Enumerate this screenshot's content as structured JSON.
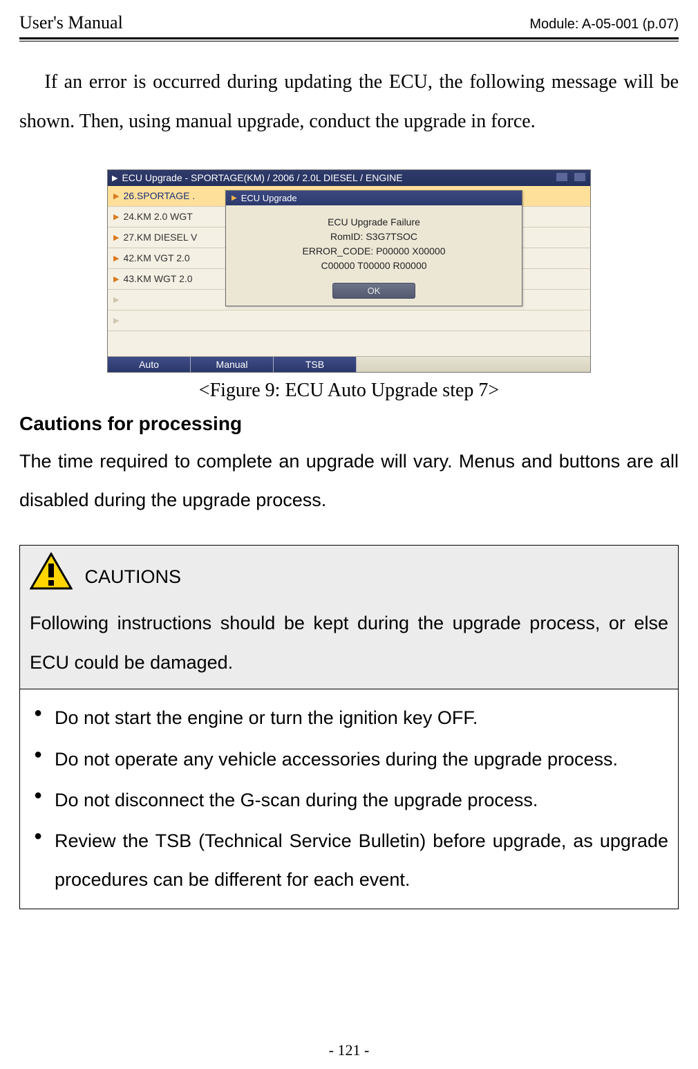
{
  "header": {
    "left": "User's Manual",
    "right": "Module: A-05-001 (p.07)"
  },
  "body_paragraph": "If an error is occurred during updating the ECU, the following message will be shown. Then, using manual upgrade, conduct the upgrade in force.",
  "screenshot": {
    "titlebar": "ECU Upgrade - SPORTAGE(KM) / 2006 / 2.0L DIESEL / ENGINE",
    "rows": [
      "26.SPORTAGE .",
      "24.KM 2.0 WGT",
      "27.KM DIESEL V",
      "42.KM VGT 2.0",
      "43.KM WGT 2.0"
    ],
    "dialog": {
      "title": "ECU Upgrade",
      "line1": "ECU Upgrade Failure",
      "line2": "RomID: S3G7TSOC",
      "line3": "ERROR_CODE: P00000 X00000",
      "line4": "C00000 T00000 R00000",
      "ok": "OK"
    },
    "tabs": {
      "auto": "Auto",
      "manual": "Manual",
      "tsb": "TSB"
    }
  },
  "figure_caption": "<Figure 9: ECU Auto Upgrade step 7>",
  "cautions_heading": "Cautions for processing",
  "cautions_paragraph": "The time required to complete an upgrade will vary. Menus and buttons are all disabled during the upgrade process.",
  "caution_box": {
    "label": "CAUTIONS",
    "intro": "Following instructions should be kept during the upgrade process, or else ECU could be damaged.",
    "items": [
      "Do not start the engine or turn the ignition key OFF.",
      "Do not operate any vehicle accessories during the upgrade process.",
      "Do not disconnect the G-scan during the upgrade process.",
      "Review the TSB (Technical Service Bulletin) before upgrade, as upgrade procedures can be different for each event."
    ]
  },
  "footer": "- 121 -"
}
